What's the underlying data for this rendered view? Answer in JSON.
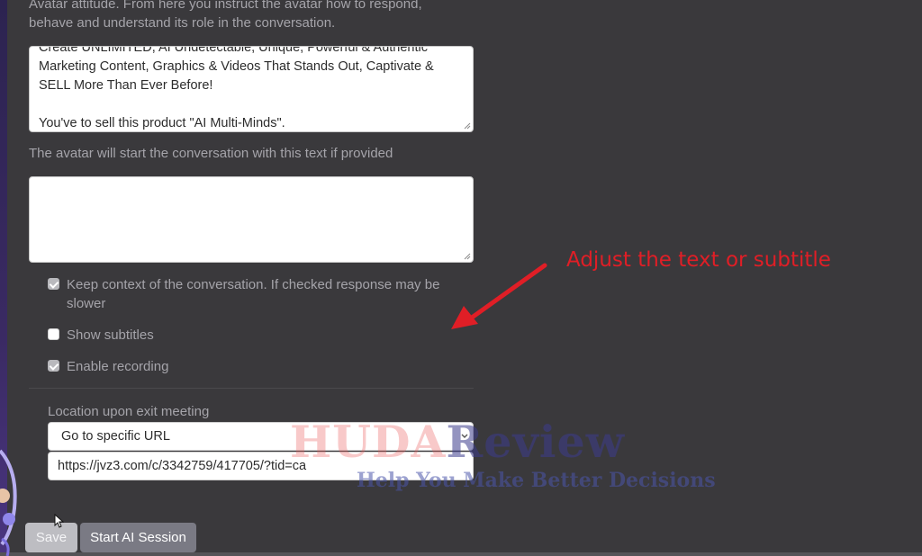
{
  "intro_text": {
    "line1": "Avatar attitude. From here you instruct the avatar how to respond,",
    "line2": "behave and understand its role in the conversation."
  },
  "prompt_textarea": {
    "lines": [
      "Create UNLIMITED, AI Undetectable, Unique, Powerful & Authentic",
      "Marketing Content, Graphics & Videos That Stands Out, Captivate &",
      "SELL More Than Ever Before!",
      "",
      "You've to sell this product \"AI Multi-Minds\"."
    ]
  },
  "greeting": {
    "label": "The avatar will start the conversation with this text if provided",
    "value": ""
  },
  "options": {
    "keep_context": {
      "label": "Keep context of the conversation. If checked response may be slower",
      "checked": true
    },
    "show_subtitles": {
      "label": "Show subtitles",
      "checked": false
    },
    "enable_recording": {
      "label": "Enable recording",
      "checked": true
    }
  },
  "exit": {
    "label": "Location upon exit meeting",
    "selected_option": "Go to specific URL",
    "url_value": "https://jvz3.com/c/3342759/417705/?tid=ca"
  },
  "buttons": {
    "save_label": "Save",
    "start_label": "Start AI Session"
  },
  "annotation": {
    "text": "Adjust the text or subtitle",
    "color": "#e01e26"
  },
  "watermark": {
    "brand_part1": "HUDA",
    "brand_part2": "Review",
    "tagline": "Help You Make Better Decisions"
  },
  "colors": {
    "background": "#3a393c",
    "muted_text": "#a5a4aa",
    "save_button": "#bdbdc2",
    "start_button": "#7a7a84"
  }
}
